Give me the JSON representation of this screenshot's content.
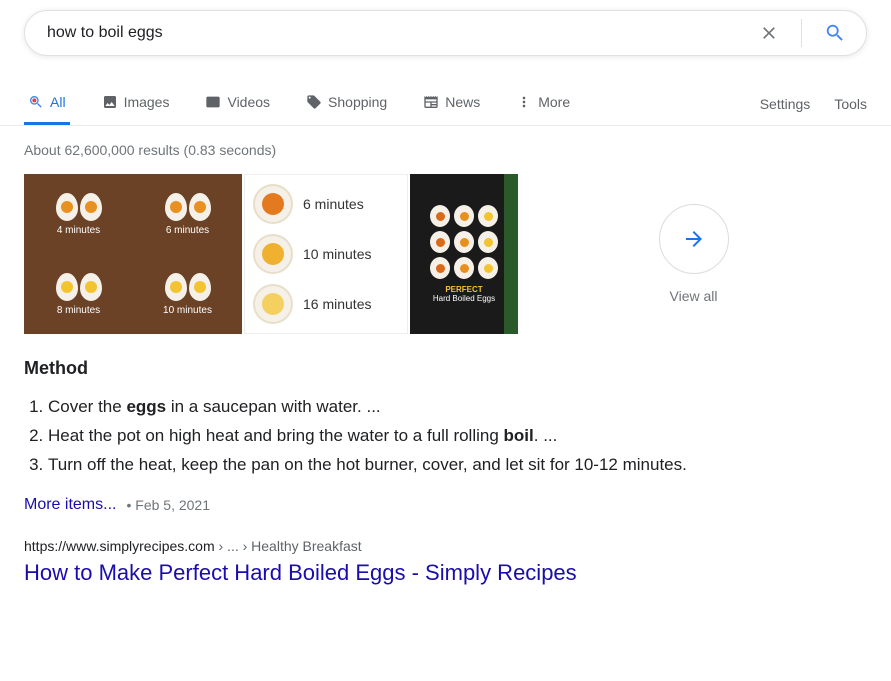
{
  "search": {
    "query": "how to boil eggs"
  },
  "tabs": {
    "all": "All",
    "images": "Images",
    "videos": "Videos",
    "shopping": "Shopping",
    "news": "News",
    "more": "More"
  },
  "tools": {
    "settings": "Settings",
    "tools": "Tools"
  },
  "stats": "About 62,600,000 results (0.83 seconds)",
  "thumbs": {
    "t1": {
      "a": "4 minutes",
      "b": "6 minutes",
      "c": "8 minutes",
      "d": "10 minutes"
    },
    "t2": {
      "a": "6 minutes",
      "b": "10 minutes",
      "c": "16 minutes"
    },
    "t3": {
      "line1": "PERFECT",
      "line2": "Hard Boiled Eggs"
    }
  },
  "viewAll": "View all",
  "method": {
    "title": "Method",
    "step1_a": "Cover the ",
    "step1_b": "eggs",
    "step1_c": " in a saucepan with water. ...",
    "step2_a": "Heat the pot on high heat and bring the water to a full rolling ",
    "step2_b": "boil",
    "step2_c": ". ...",
    "step3": "Turn off the heat, keep the pan on the hot burner, cover, and let sit for 10-12 minutes."
  },
  "moreItems": "More items...",
  "date": "Feb 5, 2021",
  "result": {
    "domain": "https://www.simplyrecipes.com",
    "path": " › ... › Healthy Breakfast",
    "title": "How to Make Perfect Hard Boiled Eggs - Simply Recipes"
  }
}
